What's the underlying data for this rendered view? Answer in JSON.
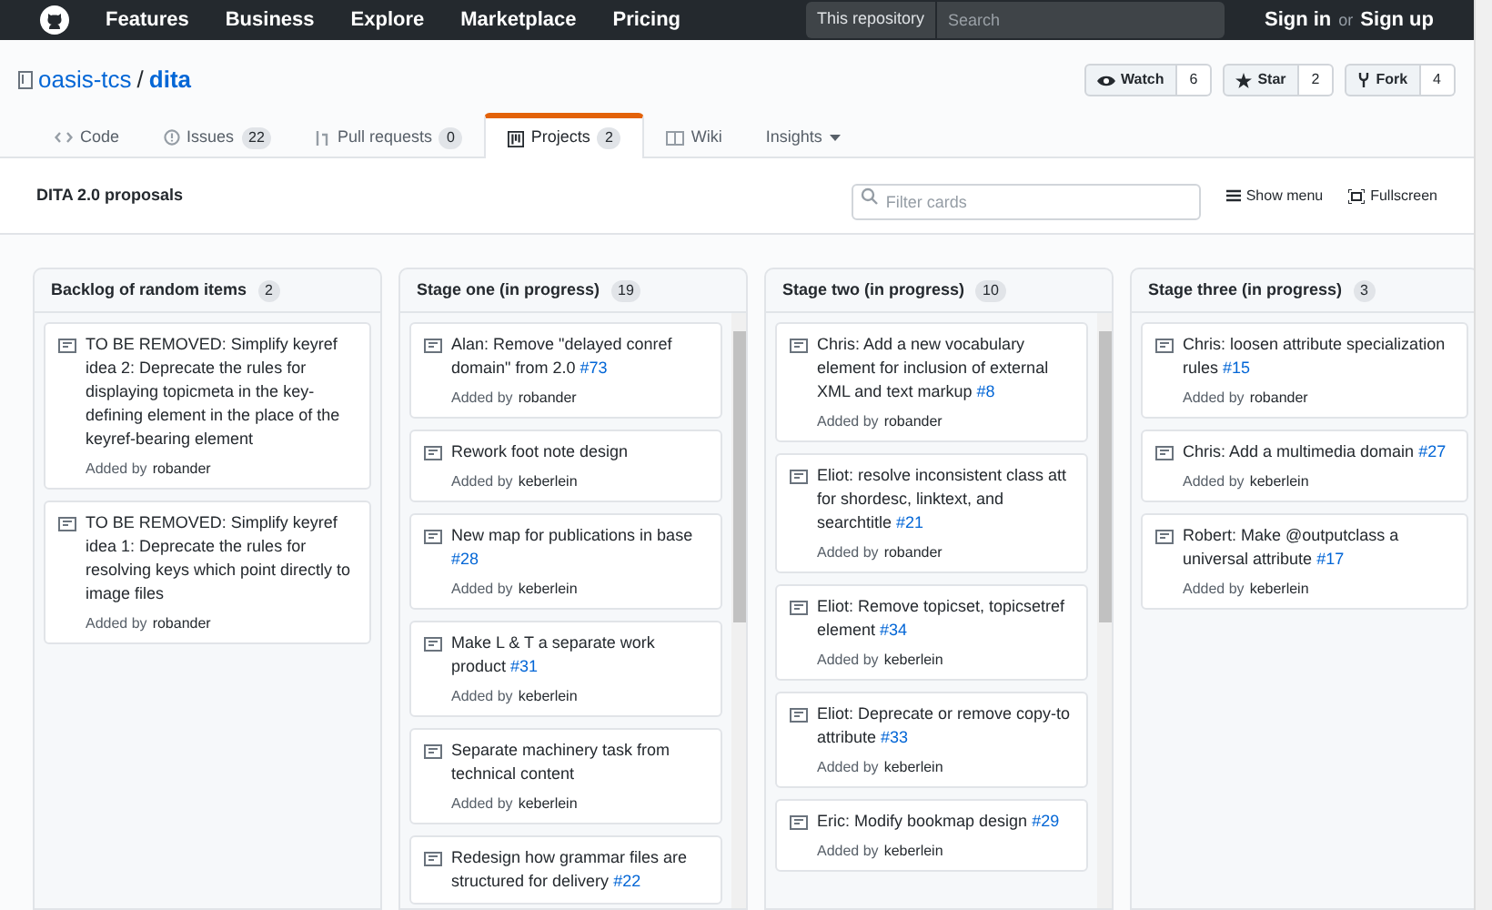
{
  "top_nav": {
    "items": [
      "Features",
      "Business",
      "Explore",
      "Marketplace",
      "Pricing"
    ],
    "search_scope": "This repository",
    "search_placeholder": "Search",
    "sign_in": "Sign in",
    "or": "or",
    "sign_up": "Sign up"
  },
  "repo": {
    "owner": "oasis-tcs",
    "separator": "/",
    "name": "dita"
  },
  "repo_actions": [
    {
      "label": "Watch",
      "count": "6",
      "kind": "watch"
    },
    {
      "label": "Star",
      "count": "2",
      "kind": "star"
    },
    {
      "label": "Fork",
      "count": "4",
      "kind": "fork"
    }
  ],
  "tabs": [
    {
      "label": "Code",
      "kind": "code",
      "selected": false
    },
    {
      "label": "Issues",
      "count": "22",
      "kind": "issues",
      "selected": false
    },
    {
      "label": "Pull requests",
      "count": "0",
      "kind": "pr",
      "selected": false
    },
    {
      "label": "Projects",
      "count": "2",
      "kind": "projects",
      "selected": true
    },
    {
      "label": "Wiki",
      "kind": "wiki",
      "selected": false
    },
    {
      "label": "Insights",
      "kind": "insights",
      "selected": false
    }
  ],
  "project": {
    "title": "DITA 2.0 proposals",
    "filter_placeholder": "Filter cards",
    "show_menu": "Show menu",
    "fullscreen": "Fullscreen"
  },
  "columns": [
    {
      "title": "Backlog of random items",
      "count": "2",
      "scrollbar": false,
      "cards": [
        {
          "title": "TO BE REMOVED: Simplify keyref idea 2: Deprecate the rules for displaying topicmeta in the key-defining element in the place of the keyref-bearing element",
          "added": "Added by",
          "author": "robander"
        },
        {
          "title": "TO BE REMOVED: Simplify keyref idea 1: Deprecate the rules for resolving keys which point directly to image files",
          "added": "Added by",
          "author": "robander"
        }
      ]
    },
    {
      "title": "Stage one (in progress)",
      "count": "19",
      "scrollbar": true,
      "cards": [
        {
          "title": "Alan: Remove \"delayed conref domain\" from 2.0",
          "issue": "#73",
          "added": "Added by",
          "author": "robander"
        },
        {
          "title": "Rework foot note design",
          "added": "Added by",
          "author": "keberlein"
        },
        {
          "title": "New map for publications in base",
          "issue": "#28",
          "added": "Added by",
          "author": "keberlein"
        },
        {
          "title": "Make L & T a separate work product",
          "issue": "#31",
          "added": "Added by",
          "author": "keberlein"
        },
        {
          "title": "Separate machinery task from technical content",
          "added": "Added by",
          "author": "keberlein"
        },
        {
          "title": "Redesign how grammar files are structured for delivery",
          "issue": "#22"
        }
      ]
    },
    {
      "title": "Stage two (in progress)",
      "count": "10",
      "scrollbar": true,
      "cards": [
        {
          "title": "Chris: Add a new vocabulary element for inclusion of external XML and text markup",
          "issue": "#8",
          "added": "Added by",
          "author": "robander"
        },
        {
          "title": "Eliot: resolve inconsistent class att for shordesc, linktext, and searchtitle",
          "issue": "#21",
          "added": "Added by",
          "author": "robander"
        },
        {
          "title": "Eliot: Remove topicset, topicsetref element",
          "issue": "#34",
          "added": "Added by",
          "author": "keberlein"
        },
        {
          "title": "Eliot: Deprecate or remove copy-to attribute",
          "issue": "#33",
          "added": "Added by",
          "author": "keberlein"
        },
        {
          "title": "Eric: Modify bookmap design",
          "issue": "#29",
          "added": "Added by",
          "author": "keberlein"
        }
      ]
    },
    {
      "title": "Stage three (in progress)",
      "count": "3",
      "scrollbar": false,
      "cards": [
        {
          "title": "Chris: loosen attribute specialization rules",
          "issue": "#15",
          "added": "Added by",
          "author": "robander"
        },
        {
          "title": "Chris: Add a multimedia domain",
          "issue": "#27",
          "added": "Added by",
          "author": "keberlein"
        },
        {
          "title": "Robert: Make @outputclass a universal attribute",
          "issue": "#17",
          "added": "Added by",
          "author": "keberlein"
        }
      ]
    }
  ]
}
